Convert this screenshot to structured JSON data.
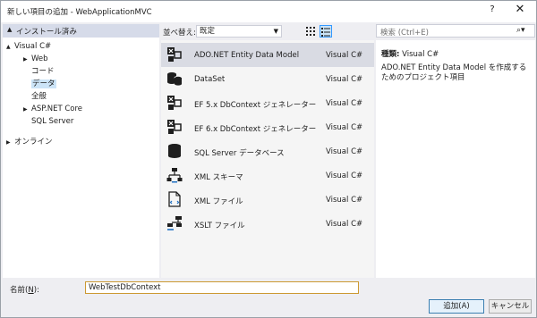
{
  "window": {
    "title": "新しい項目の追加 - WebApplicationMVC",
    "help_label": "?",
    "close_label": "✕"
  },
  "left": {
    "header_label": "インストール済み",
    "tree": [
      {
        "label": "Visual C#",
        "expander": "▲",
        "level": 0
      },
      {
        "label": "Web",
        "expander": "▶",
        "level": 1
      },
      {
        "label": "コード",
        "expander": "",
        "level": 1
      },
      {
        "label": "データ",
        "expander": "",
        "level": 1,
        "selected": true
      },
      {
        "label": "全般",
        "expander": "",
        "level": 1
      },
      {
        "label": "ASP.NET Core",
        "expander": "▶",
        "level": 1
      },
      {
        "label": "SQL Server",
        "expander": "",
        "level": 1
      }
    ],
    "online_label": "オンライン"
  },
  "toolbar": {
    "sort_label": "並べ替え:",
    "sort_value": "既定",
    "sort_caret": "▼"
  },
  "templates": [
    {
      "name": "ADO.NET Entity Data Model",
      "lang": "Visual C#",
      "icon": "entity-model-icon"
    },
    {
      "name": "DataSet",
      "lang": "Visual C#",
      "icon": "database-icon"
    },
    {
      "name": "EF 5.x DbContext ジェネレーター",
      "lang": "Visual C#",
      "icon": "dbcontext-generator-icon"
    },
    {
      "name": "EF 6.x DbContext ジェネレーター",
      "lang": "Visual C#",
      "icon": "dbcontext-generator-icon"
    },
    {
      "name": "SQL Server データベース",
      "lang": "Visual C#",
      "icon": "sql-database-icon"
    },
    {
      "name": "XML スキーマ",
      "lang": "Visual C#",
      "icon": "xml-schema-icon"
    },
    {
      "name": "XML ファイル",
      "lang": "Visual C#",
      "icon": "xml-file-icon"
    },
    {
      "name": "XSLT ファイル",
      "lang": "Visual C#",
      "icon": "xslt-file-icon"
    }
  ],
  "search": {
    "placeholder": "検索 (Ctrl+E)",
    "icon_glyph": "⌕▾"
  },
  "details": {
    "type_label": "種類:",
    "type_value": "Visual C#",
    "description": "ADO.NET Entity Data Model を作成するためのプロジェクト項目"
  },
  "bottom": {
    "name_label_prefix": "名前(",
    "name_label_key": "N",
    "name_label_suffix": "):",
    "name_value": "WebTestDbContext",
    "add_label": "追加(A)",
    "cancel_label": "キャンセル"
  },
  "colors": {
    "accent": "#3399ff",
    "selection": "#cce4f7",
    "icon_dark": "#1e1e1e",
    "icon_blue": "#1e6fc1"
  }
}
